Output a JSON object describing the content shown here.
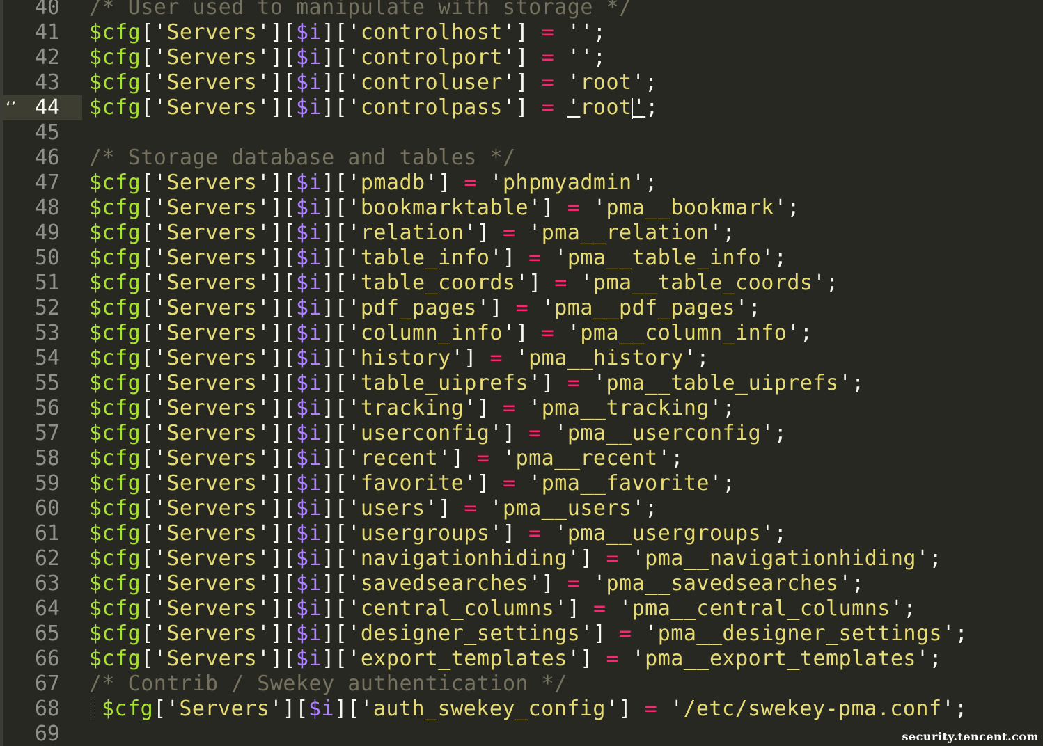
{
  "editor": {
    "lines": [
      {
        "num": "40",
        "text": "/* User used to manipulate with storage */",
        "kind": "comment"
      },
      {
        "num": "41",
        "key": "controlhost",
        "value": ""
      },
      {
        "num": "42",
        "key": "controlport",
        "value": ""
      },
      {
        "num": "43",
        "key": "controluser",
        "value": "root"
      },
      {
        "num": "44",
        "key": "controlpass",
        "value": "root",
        "active": true
      },
      {
        "num": "45",
        "kind": "blank"
      },
      {
        "num": "46",
        "text": "/* Storage database and tables */",
        "kind": "comment"
      },
      {
        "num": "47",
        "key": "pmadb",
        "value": "phpmyadmin"
      },
      {
        "num": "48",
        "key": "bookmarktable",
        "value": "pma__bookmark"
      },
      {
        "num": "49",
        "key": "relation",
        "value": "pma__relation"
      },
      {
        "num": "50",
        "key": "table_info",
        "value": "pma__table_info"
      },
      {
        "num": "51",
        "key": "table_coords",
        "value": "pma__table_coords"
      },
      {
        "num": "52",
        "key": "pdf_pages",
        "value": "pma__pdf_pages"
      },
      {
        "num": "53",
        "key": "column_info",
        "value": "pma__column_info"
      },
      {
        "num": "54",
        "key": "history",
        "value": "pma__history"
      },
      {
        "num": "55",
        "key": "table_uiprefs",
        "value": "pma__table_uiprefs"
      },
      {
        "num": "56",
        "key": "tracking",
        "value": "pma__tracking"
      },
      {
        "num": "57",
        "key": "userconfig",
        "value": "pma__userconfig"
      },
      {
        "num": "58",
        "key": "recent",
        "value": "pma__recent"
      },
      {
        "num": "59",
        "key": "favorite",
        "value": "pma__favorite"
      },
      {
        "num": "60",
        "key": "users",
        "value": "pma__users"
      },
      {
        "num": "61",
        "key": "usergroups",
        "value": "pma__usergroups"
      },
      {
        "num": "62",
        "key": "navigationhiding",
        "value": "pma__navigationhiding"
      },
      {
        "num": "63",
        "key": "savedsearches",
        "value": "pma__savedsearches"
      },
      {
        "num": "64",
        "key": "central_columns",
        "value": "pma__central_columns"
      },
      {
        "num": "65",
        "key": "designer_settings",
        "value": "pma__designer_settings"
      },
      {
        "num": "66",
        "key": "export_templates",
        "value": "pma__export_templates"
      },
      {
        "num": "67",
        "text": "/* Contrib / Swekey authentication */",
        "kind": "comment"
      },
      {
        "num": "68",
        "key": "auth_swekey_config",
        "value": "/etc/swekey-pma.conf",
        "indented": true
      },
      {
        "num": "69",
        "kind": "blank"
      }
    ],
    "tokens": {
      "var": "$cfg",
      "servers": "Servers",
      "index": "$i"
    },
    "gutter_mark_icon": "bookmark-icon"
  },
  "colors": {
    "background": "#272822",
    "variable": "#A6E22E",
    "string": "#E6DB74",
    "operator": "#F92672",
    "index_var": "#AE81FF",
    "comment": "#75715E",
    "line_number": "#90908A"
  },
  "watermark": {
    "text": "security.tencent.com"
  }
}
